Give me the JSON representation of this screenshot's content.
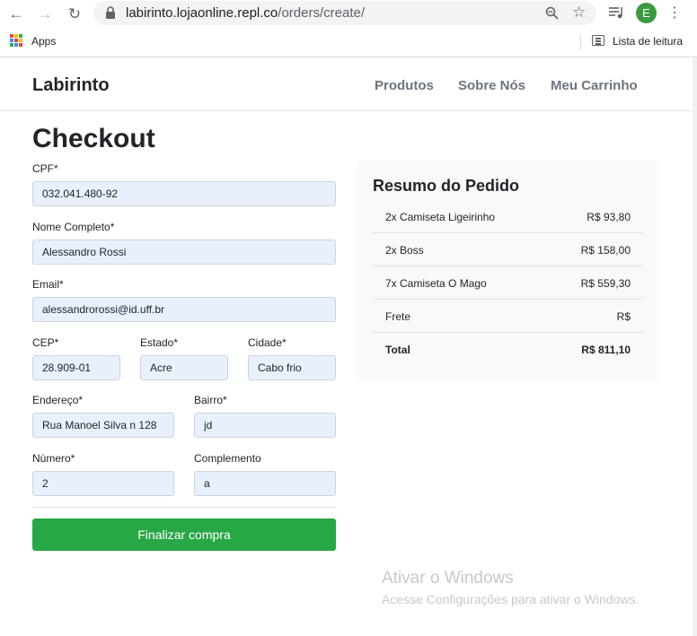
{
  "browser": {
    "url_host": "labirinto.lojaonline.repl.co",
    "url_path": "/orders/create/",
    "profile_initial": "E",
    "bookmarks_apps": "Apps",
    "reading_list": "Lista de leitura",
    "icons": {
      "back": "back-arrow-icon",
      "forward": "forward-arrow-icon",
      "reload": "reload-icon",
      "lock": "lock-icon",
      "zoom": "zoom-icon",
      "star": "star-icon",
      "media": "media-control-icon",
      "menu": "kebab-menu-icon"
    }
  },
  "site": {
    "brand": "Labirinto",
    "nav": [
      "Produtos",
      "Sobre Nós",
      "Meu Carrinho"
    ]
  },
  "page": {
    "title": "Checkout"
  },
  "form": {
    "cpf": {
      "label": "CPF*",
      "value": "032.041.480-92"
    },
    "nome": {
      "label": "Nome Completo*",
      "value": "Alessandro Rossi"
    },
    "email": {
      "label": "Email*",
      "value": "alessandrorossi@id.uff.br"
    },
    "cep": {
      "label": "CEP*",
      "value": "28.909-01"
    },
    "estado": {
      "label": "Estado*",
      "value": "Acre"
    },
    "cidade": {
      "label": "Cidade*",
      "value": "Cabo frio"
    },
    "endereco": {
      "label": "Endereço*",
      "value": "Rua Manoel Silva n 128"
    },
    "bairro": {
      "label": "Bairro*",
      "value": "jd"
    },
    "numero": {
      "label": "Número*",
      "value": "2"
    },
    "complemento": {
      "label": "Complemento",
      "value": "a"
    },
    "submit_label": "Finalizar compra"
  },
  "summary": {
    "title": "Resumo do Pedido",
    "items": [
      {
        "item": "2x Camiseta Ligeirinho",
        "price": "R$ 93,80"
      },
      {
        "item": "2x Boss",
        "price": "R$ 158,00"
      },
      {
        "item": "7x Camiseta O Mago",
        "price": "R$ 559,30"
      },
      {
        "item": "Frete",
        "price": "R$"
      }
    ],
    "total": {
      "label": "Total",
      "value": "R$ 811,10"
    }
  },
  "watermark": {
    "title": "Ativar o Windows",
    "subtitle": "Acesse Configurações para ativar o Windows."
  },
  "colors": {
    "accent_green": "#28a745",
    "autofill_bg": "#e8f0fe",
    "nav_muted": "#6c757d",
    "avatar_bg": "#3b9a3e"
  }
}
